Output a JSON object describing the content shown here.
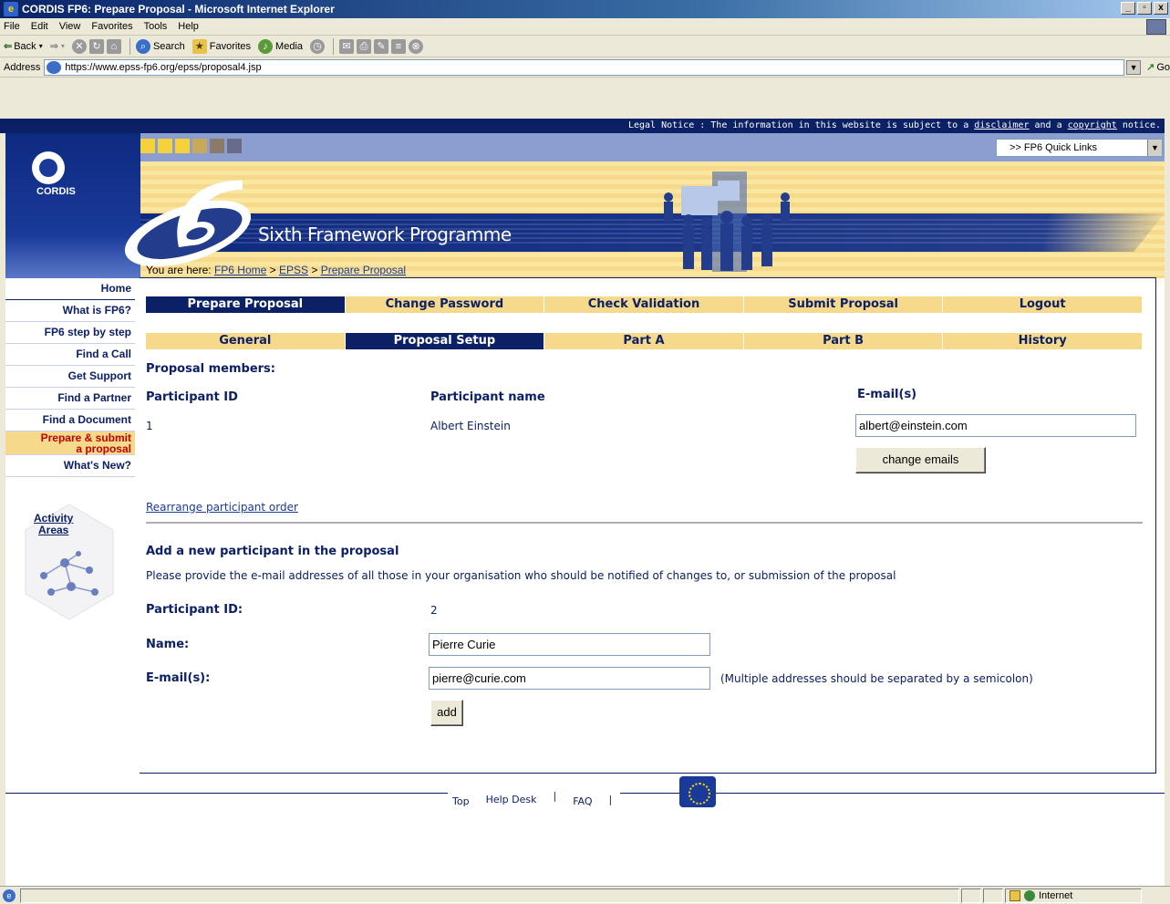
{
  "window": {
    "title": "CORDIS FP6: Prepare Proposal - Microsoft Internet Explorer",
    "controls": [
      "_",
      "▯",
      "x"
    ]
  },
  "menu": [
    "File",
    "Edit",
    "View",
    "Favorites",
    "Tools",
    "Help"
  ],
  "toolbar": {
    "back": "Back",
    "search": "Search",
    "favorites": "Favorites",
    "media": "Media"
  },
  "address": {
    "label": "Address",
    "url": "https://www.epss-fp6.org/epss/proposal4.jsp",
    "go": "Go"
  },
  "header": {
    "legal_prefix": "Legal Notice : The information in this website is subject to a ",
    "disclaimer": "disclaimer",
    "legal_mid": " and a ",
    "copyright": "copyright",
    "legal_suffix": " notice.",
    "quicklinks": ">> FP6 Quick Links",
    "cordis": "CORDIS",
    "programme": "Sixth Framework Programme",
    "square_colors": [
      "#f5d23c",
      "#f5d23c",
      "#f5d23c",
      "#c9a85a",
      "#8a7a6a",
      "#6a6a8a"
    ]
  },
  "leftnav": {
    "items": [
      "Home",
      "What is FP6?",
      "FP6 step by step",
      "Find a Call",
      "Get Support",
      "Find a Partner",
      "Find a Document",
      "Prepare & submit\na proposal",
      "What's New?"
    ],
    "activity_line1": "Activity",
    "activity_line2": "Areas"
  },
  "breadcrumb": {
    "prefix": "You are here: ",
    "home": "FP6 Home",
    "sep": " > ",
    "epss": "EPSS",
    "current": "Prepare Proposal"
  },
  "tabs_main": [
    "Prepare Proposal",
    "Change Password",
    "Check Validation",
    "Submit Proposal",
    "Logout"
  ],
  "tabs_sub": [
    "General",
    "Proposal Setup",
    "Part A",
    "Part B",
    "History"
  ],
  "members": {
    "heading": "Proposal members:",
    "col_id": "Participant ID",
    "col_name": "Participant name",
    "col_email": "E-mail(s)",
    "rows": [
      {
        "id": "1",
        "name": "Albert Einstein",
        "email": "albert@einstein.com"
      }
    ],
    "change_btn": "change emails",
    "rearrange": "Rearrange participant order"
  },
  "add_participant": {
    "heading": "Add a new participant in the proposal",
    "instructions": "Please provide the e-mail addresses of all those in your organisation who should be notified of changes to, or submission of the proposal",
    "id_label": "Participant ID:",
    "id_value": "2",
    "name_label": "Name:",
    "name_value": "Pierre Curie",
    "email_label": "E-mail(s):",
    "email_value": "pierre@curie.com",
    "email_hint": "(Multiple addresses should be separated by a semicolon)",
    "add_btn": "add"
  },
  "footer": {
    "top": "Top",
    "helpdesk": "Help Desk",
    "faq": "FAQ"
  },
  "status": {
    "zone": "Internet"
  }
}
